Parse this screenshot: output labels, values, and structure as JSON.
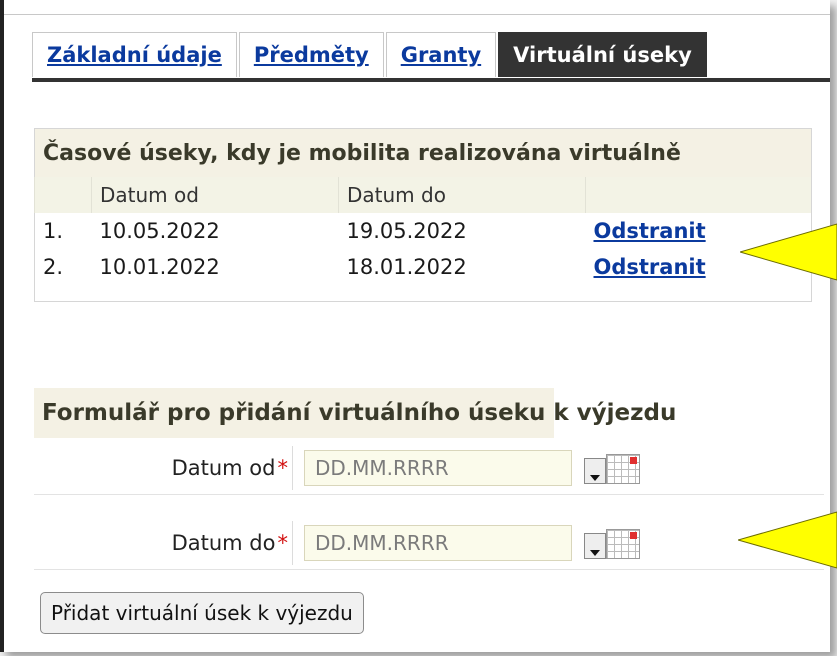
{
  "tabs": [
    {
      "label": "Základní údaje",
      "active": false
    },
    {
      "label": "Předměty",
      "active": false
    },
    {
      "label": "Granty",
      "active": false
    },
    {
      "label": "Virtuální úseky",
      "active": true
    }
  ],
  "segments_table": {
    "caption": "Časové úseky, kdy je mobilita realizována virtuálně",
    "columns": [
      "",
      "Datum od",
      "Datum do",
      ""
    ],
    "rows": [
      {
        "num": "1.",
        "from": "10.05.2022",
        "to": "19.05.2022",
        "action": "Odstranit"
      },
      {
        "num": "2.",
        "from": "10.01.2022",
        "to": "18.01.2022",
        "action": "Odstranit"
      }
    ]
  },
  "form": {
    "caption": "Formulář pro přidání virtuálního úseku k výjezdu",
    "from_label": "Datum od",
    "to_label": "Datum do",
    "required_mark": "*",
    "from_placeholder": "DD.MM.RRRR",
    "to_placeholder": "DD.MM.RRRR",
    "submit_label": "Přidat virtuální úsek k výjezdu"
  },
  "colors": {
    "accent_link": "#0b3a9e",
    "active_tab": "#333333",
    "callout": "#ffff00",
    "required": "#d21010"
  },
  "icons": [
    "dropdown-icon",
    "calendar-icon"
  ]
}
